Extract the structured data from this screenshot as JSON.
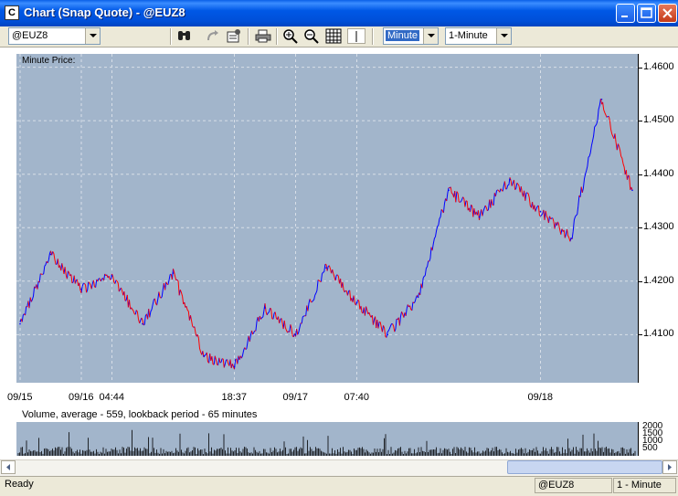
{
  "window": {
    "title": "Chart (Snap Quote) - @EUZ8",
    "app_icon": "chart-app-icon"
  },
  "toolbar": {
    "symbol_value": "@EUZ8",
    "interval_type_value": "Minute",
    "interval_value": "1-Minute",
    "icons": [
      "binoculars-icon",
      "redo-icon",
      "properties-icon",
      "print-icon",
      "zoom-in-icon",
      "zoom-out-icon",
      "grid-icon",
      "cursor-icon"
    ]
  },
  "chart": {
    "price_panel_label": "Minute Price:",
    "volume_panel_label": "Volume, average - 559, lookback period - 65 minutes",
    "y_ticks": [
      "1.4600",
      "1.4500",
      "1.4400",
      "1.4300",
      "1.4200",
      "1.4100"
    ],
    "volume_ticks": [
      "2000",
      "1500",
      "1000",
      "500"
    ],
    "x_ticks": [
      "09/15",
      "09/16",
      "04:44",
      "18:37",
      "09/17",
      "07:40",
      "09/18"
    ],
    "colors": {
      "background": "#a2b5cb",
      "up": "#0000ff",
      "down": "#ff0000",
      "volume": "#000000"
    }
  },
  "chart_data": {
    "type": "line",
    "title": "Minute Price:",
    "xlabel": "",
    "ylabel": "",
    "ylim": [
      1.401,
      1.4625
    ],
    "x": [
      "09/15",
      "",
      "09/16",
      "04:44",
      "",
      "",
      "",
      "18:37",
      "",
      "09/17",
      "",
      "07:40",
      "",
      "",
      "",
      "",
      "",
      "09/18",
      "",
      "",
      ""
    ],
    "series": [
      {
        "name": "",
        "values": [
          1.412,
          1.425,
          1.4185,
          1.421,
          1.412,
          1.4215,
          1.406,
          1.404,
          1.415,
          1.41,
          1.4225,
          1.416,
          1.41,
          1.417,
          1.437,
          1.432,
          1.439,
          1.433,
          1.428,
          1.454,
          1.437
        ]
      }
    ],
    "volume_avg": 559
  },
  "statusbar": {
    "status": "Ready",
    "symbol": "@EUZ8",
    "interval": "1 - Minute"
  }
}
